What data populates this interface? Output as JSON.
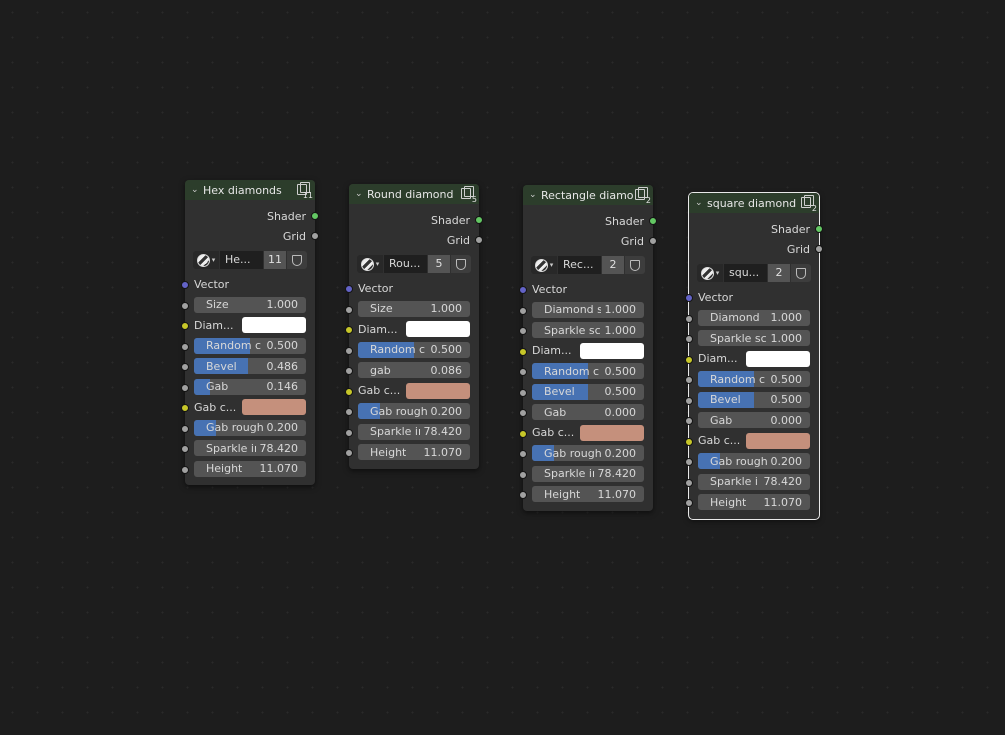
{
  "nodes": [
    {
      "title": "Hex diamonds",
      "user_count": "11",
      "outputs": [
        "Shader",
        "Grid"
      ],
      "group": {
        "name": "He...",
        "users": "11"
      },
      "inputs": [
        {
          "type": "label",
          "label": "Vector"
        },
        {
          "type": "field",
          "label": "Size",
          "value": "1.000",
          "fill": 0
        },
        {
          "type": "color",
          "label": "Diam...",
          "color": "#ffffff"
        },
        {
          "type": "field",
          "label": "Random c",
          "value": "0.500",
          "fill": 0.5
        },
        {
          "type": "field",
          "label": "Bevel",
          "value": "0.486",
          "fill": 0.486
        },
        {
          "type": "field",
          "label": "Gab",
          "value": "0.146",
          "fill": 0.146
        },
        {
          "type": "color",
          "label": "Gab c...",
          "color": "#c5907c"
        },
        {
          "type": "field",
          "label": "Gab rough",
          "value": "0.200",
          "fill": 0.2
        },
        {
          "type": "field",
          "label": "Sparkle in",
          "value": "78.420",
          "fill": 0
        },
        {
          "type": "field",
          "label": "Height",
          "value": "11.070",
          "fill": 0
        }
      ]
    },
    {
      "title": "Round diamond",
      "user_count": "5",
      "outputs": [
        "Shader",
        "Grid"
      ],
      "group": {
        "name": "Rou...",
        "users": "5"
      },
      "inputs": [
        {
          "type": "label",
          "label": "Vector"
        },
        {
          "type": "field",
          "label": "Size",
          "value": "1.000",
          "fill": 0
        },
        {
          "type": "color",
          "label": "Diam...",
          "color": "#ffffff"
        },
        {
          "type": "field",
          "label": "Random c",
          "value": "0.500",
          "fill": 0.5
        },
        {
          "type": "field",
          "label": "gab",
          "value": "0.086",
          "fill": 0
        },
        {
          "type": "color",
          "label": "Gab c...",
          "color": "#c5907c"
        },
        {
          "type": "field",
          "label": "Gab rough",
          "value": "0.200",
          "fill": 0.2
        },
        {
          "type": "field",
          "label": "Sparkle in",
          "value": "78.420",
          "fill": 0
        },
        {
          "type": "field",
          "label": "Height",
          "value": "11.070",
          "fill": 0
        }
      ]
    },
    {
      "title": "Rectangle diamo...",
      "user_count": "2",
      "outputs": [
        "Shader",
        "Grid"
      ],
      "group": {
        "name": "Rec...",
        "users": "2"
      },
      "inputs": [
        {
          "type": "label",
          "label": "Vector"
        },
        {
          "type": "field",
          "label": "Diamond s",
          "value": "1.000",
          "fill": 0
        },
        {
          "type": "field",
          "label": "Sparkle sc",
          "value": "1.000",
          "fill": 0
        },
        {
          "type": "color",
          "label": "Diam...",
          "color": "#ffffff"
        },
        {
          "type": "field",
          "label": "Random c",
          "value": "0.500",
          "fill": 0.5
        },
        {
          "type": "field",
          "label": "Bevel",
          "value": "0.500",
          "fill": 0.5
        },
        {
          "type": "field",
          "label": "Gab",
          "value": "0.000",
          "fill": 0
        },
        {
          "type": "color",
          "label": "Gab c...",
          "color": "#c5907c"
        },
        {
          "type": "field",
          "label": "Gab rough",
          "value": "0.200",
          "fill": 0.2
        },
        {
          "type": "field",
          "label": "Sparkle in",
          "value": "78.420",
          "fill": 0
        },
        {
          "type": "field",
          "label": "Height",
          "value": "11.070",
          "fill": 0
        }
      ]
    },
    {
      "title": "square diamond",
      "user_count": "2",
      "outputs": [
        "Shader",
        "Grid"
      ],
      "group": {
        "name": "squ...",
        "users": "2"
      },
      "selected": true,
      "inputs": [
        {
          "type": "label",
          "label": "Vector"
        },
        {
          "type": "field",
          "label": "Diamond",
          "value": "1.000",
          "fill": 0
        },
        {
          "type": "field",
          "label": "Sparkle sc",
          "value": "1.000",
          "fill": 0
        },
        {
          "type": "color",
          "label": "Diam...",
          "color": "#ffffff"
        },
        {
          "type": "field",
          "label": "Random c",
          "value": "0.500",
          "fill": 0.5
        },
        {
          "type": "field",
          "label": "Bevel",
          "value": "0.500",
          "fill": 0.5
        },
        {
          "type": "field",
          "label": "Gab",
          "value": "0.000",
          "fill": 0
        },
        {
          "type": "color",
          "label": "Gab c...",
          "color": "#c5907c"
        },
        {
          "type": "field",
          "label": "Gab rough",
          "value": "0.200",
          "fill": 0.2
        },
        {
          "type": "field",
          "label": "Sparkle i",
          "value": "78.420",
          "fill": 0
        },
        {
          "type": "field",
          "label": "Height",
          "value": "11.070",
          "fill": 0
        }
      ]
    }
  ]
}
